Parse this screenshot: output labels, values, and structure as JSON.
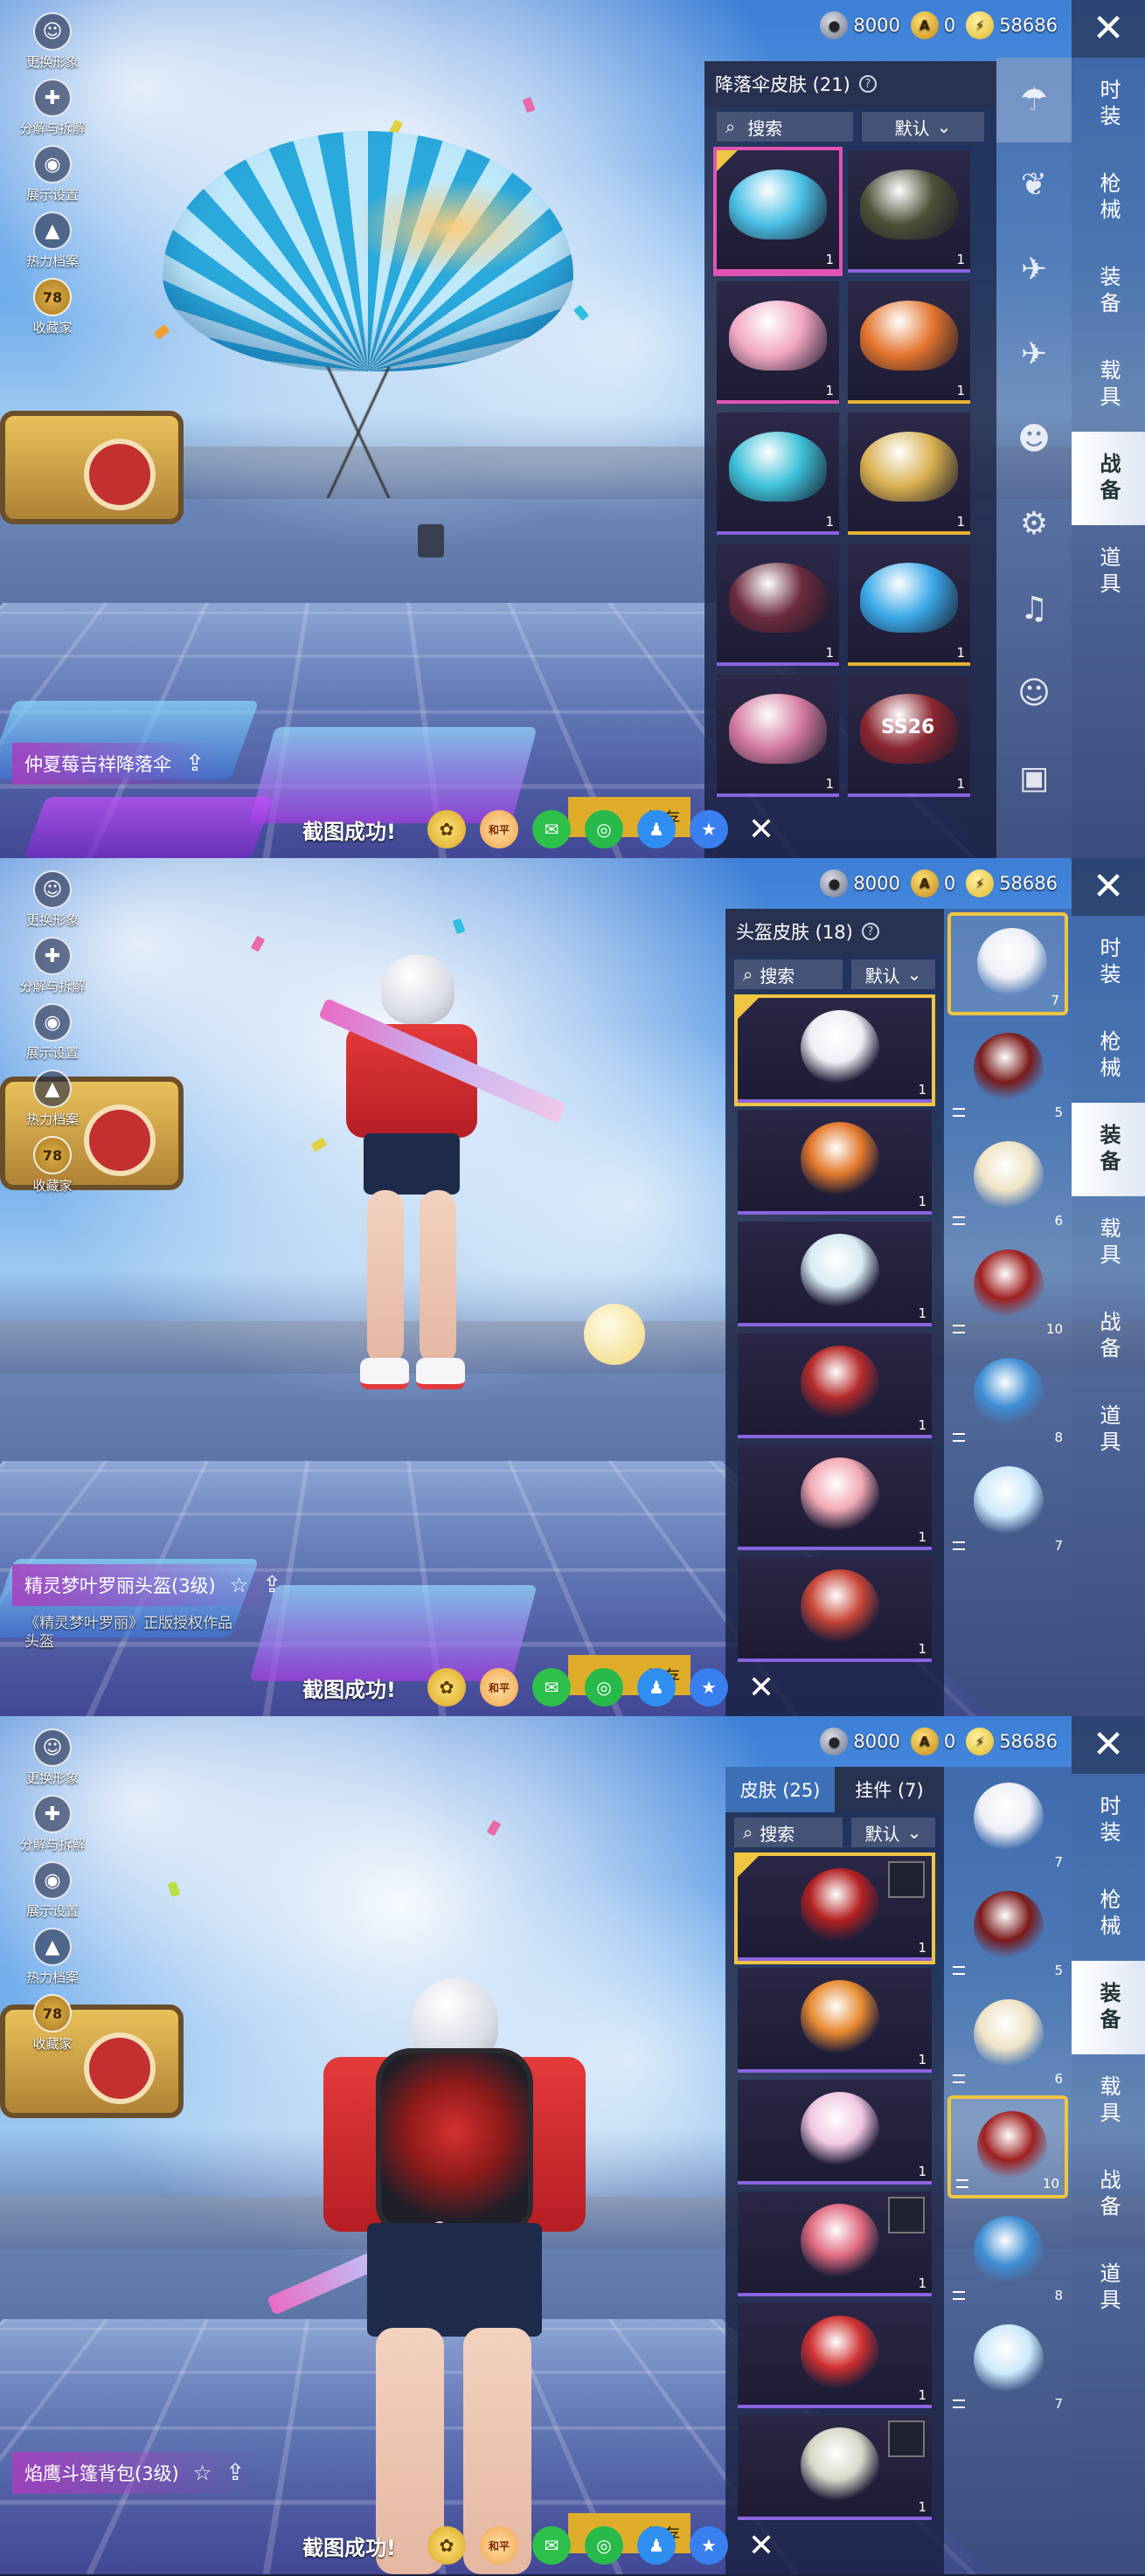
{
  "left_menu": [
    {
      "label": "更换形象",
      "icon": "avatar-icon"
    },
    {
      "label": "分解与拆解",
      "icon": "puzzle-icon"
    },
    {
      "label": "展示设置",
      "icon": "eye-icon"
    },
    {
      "label": "热力档案",
      "icon": "flame-icon"
    },
    {
      "label": "收藏家",
      "icon": "collector-badge-icon",
      "badge": "78"
    }
  ],
  "currency": {
    "silver": "8000",
    "ag": "0",
    "bp": "58686"
  },
  "category_tabs": [
    "时装",
    "枪械",
    "装备",
    "载具",
    "战备",
    "道具"
  ],
  "screenshot_bar": {
    "label": "截图成功!",
    "save_label": "保存"
  },
  "screen1": {
    "active_tab": "战备",
    "panel_title": "降落伞皮肤 (21)",
    "search_label": "搜索",
    "sort_label": "默认",
    "item_name": "仲夏莓吉祥降落伞",
    "grid": [
      {
        "count": "1",
        "color": "#4ac0e6",
        "equipped": true,
        "rarity": "pink"
      },
      {
        "count": "1",
        "color": "#4a5236",
        "equipped": false,
        "rarity": "purple"
      },
      {
        "count": "1",
        "color": "#f2a7c3",
        "equipped": false,
        "rarity": "pink"
      },
      {
        "count": "1",
        "color": "#e4742e",
        "equipped": false,
        "rarity": "gold"
      },
      {
        "count": "1",
        "color": "#3cc0d8",
        "equipped": false,
        "rarity": "purple"
      },
      {
        "count": "1",
        "color": "#d8b050",
        "equipped": false,
        "rarity": "gold"
      },
      {
        "count": "1",
        "color": "#6b2a3c",
        "equipped": false,
        "rarity": "purple"
      },
      {
        "count": "1",
        "color": "#3aa8e8",
        "equipped": false,
        "rarity": "gold"
      },
      {
        "count": "1",
        "color": "#d47aa0",
        "equipped": false,
        "rarity": "purple"
      },
      {
        "count": "1",
        "color": "#8a2530",
        "equipped": false,
        "rarity": "purple",
        "label": "SS26"
      }
    ]
  },
  "screen2": {
    "active_tab": "装备",
    "panel_title": "头盔皮肤 (18)",
    "search_label": "搜索",
    "sort_label": "默认",
    "item_name": "精灵梦叶罗丽头盔(3级)",
    "item_subtext": "《精灵梦叶罗丽》正版授权作品头盔",
    "list": [
      {
        "count": "1",
        "color": "#eef0f6",
        "equipped": true
      },
      {
        "count": "1",
        "color": "#e2782a",
        "equipped": false
      },
      {
        "count": "1",
        "color": "#d8ecf5",
        "equipped": false
      },
      {
        "count": "1",
        "color": "#b52a2a",
        "equipped": false
      },
      {
        "count": "1",
        "color": "#f2a9b4",
        "equipped": false
      },
      {
        "count": "1",
        "color": "#c84535",
        "equipped": false
      }
    ],
    "slots": [
      {
        "count": "7",
        "color": "#eef0f6",
        "selected": true
      },
      {
        "count": "5",
        "color": "#7a1a1a",
        "selected": false
      },
      {
        "count": "6",
        "color": "#f0e4c6",
        "selected": false
      },
      {
        "count": "10",
        "color": "#9e1f1f",
        "selected": false
      },
      {
        "count": "8",
        "color": "#3f8ed4",
        "selected": false
      },
      {
        "count": "7",
        "color": "#cde9fb",
        "selected": false
      }
    ]
  },
  "screen3": {
    "active_tab": "装备",
    "tab_skins": "皮肤 (25)",
    "tab_pendants": "挂件 (7)",
    "search_label": "搜索",
    "sort_label": "默认",
    "item_name": "焰鹰斗篷背包(3级)",
    "list": [
      {
        "count": "1",
        "color": "#b42020",
        "equipped": true,
        "sub": true
      },
      {
        "count": "1",
        "color": "#e88a30",
        "equipped": false,
        "sub": false
      },
      {
        "count": "1",
        "color": "#f2c8e4",
        "equipped": false,
        "sub": false
      },
      {
        "count": "1",
        "color": "#e06a80",
        "equipped": false,
        "sub": true
      },
      {
        "count": "1",
        "color": "#d03030",
        "equipped": false,
        "sub": false
      },
      {
        "count": "1",
        "color": "#d8d8c8",
        "equipped": false,
        "sub": true
      }
    ],
    "slots": [
      {
        "count": "7",
        "color": "#eef0f6",
        "selected": false
      },
      {
        "count": "5",
        "color": "#7a1a1a",
        "selected": false
      },
      {
        "count": "6",
        "color": "#f0e4c6",
        "selected": false
      },
      {
        "count": "10",
        "color": "#9e1f1f",
        "selected": true
      },
      {
        "count": "8",
        "color": "#3f8ed4",
        "selected": false
      },
      {
        "count": "7",
        "color": "#cde9fb",
        "selected": false
      }
    ]
  }
}
